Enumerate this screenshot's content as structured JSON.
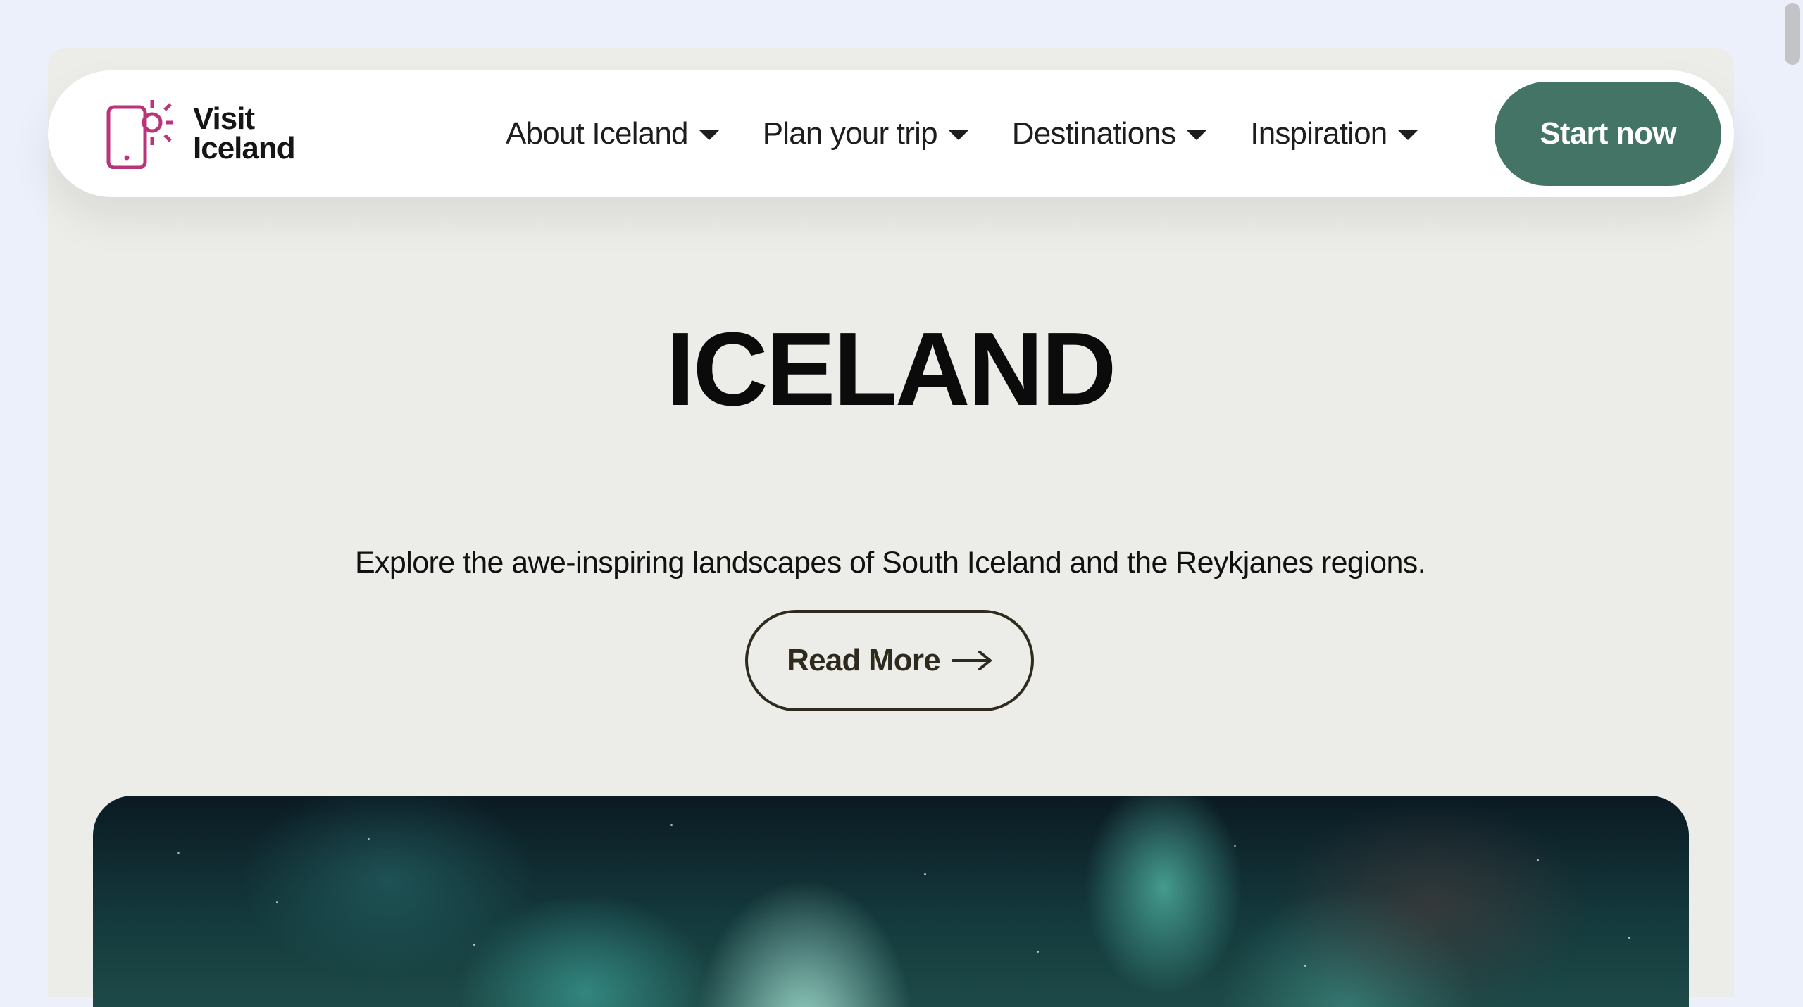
{
  "brand": {
    "line1": "Visit",
    "line2": "Iceland",
    "logo_color": "#b8357a",
    "icon": "phone-sun-icon"
  },
  "nav": {
    "items": [
      {
        "label": "About Iceland"
      },
      {
        "label": "Plan your trip"
      },
      {
        "label": "Destinations"
      },
      {
        "label": "Inspiration"
      }
    ],
    "cta_label": "Start now",
    "cta_color": "#437465"
  },
  "hero": {
    "title": "ICELAND",
    "subtitle": "Explore the awe-inspiring landscapes of South Iceland and the Reykjanes regions.",
    "button_label": "Read More",
    "button_icon": "arrow-right-icon",
    "image": "aurora-borealis-photo"
  }
}
